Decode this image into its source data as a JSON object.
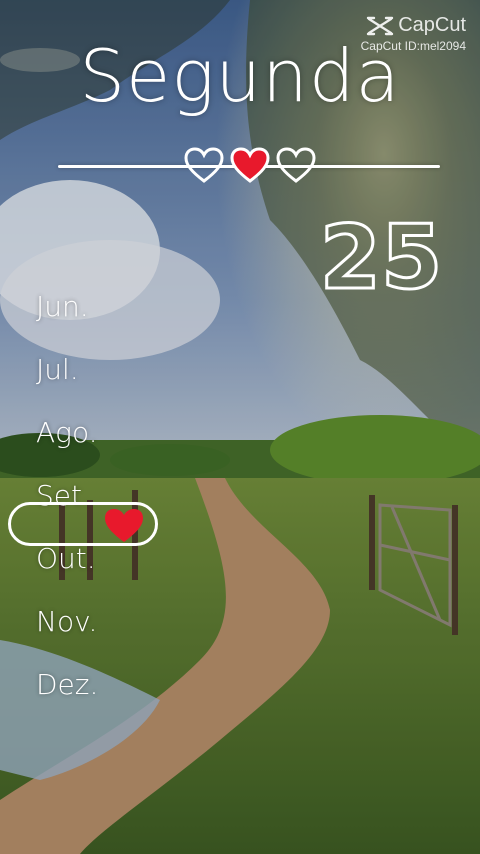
{
  "watermark": {
    "brand": "CapCut",
    "id_text": "CapCut ID:mel2094"
  },
  "day_label": "Segunda",
  "date_number": "25",
  "months": [
    "Jun.",
    "Jul.",
    "Ago.",
    "Set.",
    "Out.",
    "Nov.",
    "Dez."
  ],
  "selected_month": "Set.",
  "colors": {
    "heart_red": "#e8192c",
    "text": "#ffffff"
  },
  "icons": [
    "capcut-logo-icon",
    "heart-outline-icon",
    "heart-filled-icon"
  ]
}
